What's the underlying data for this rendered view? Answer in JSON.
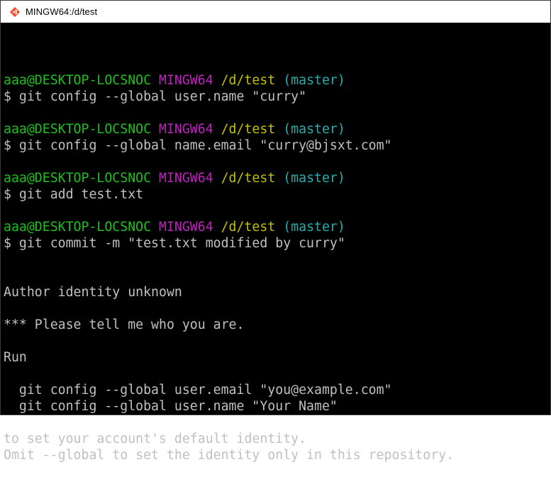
{
  "window": {
    "title": "MINGW64:/d/test",
    "icon": "git-icon"
  },
  "colors": {
    "user": "#1cc21c",
    "system": "#c020c0",
    "path": "#c0c000",
    "branch": "#20b0b0",
    "text": "#c0c0c0",
    "background": "#000000"
  },
  "prompt": {
    "user_host": "aaa@DESKTOP-LOCSNOC",
    "system": "MINGW64",
    "path": "/d/test",
    "branch": "(master)"
  },
  "blocks": [
    {
      "command": "$ git config --global user.name \"curry\""
    },
    {
      "command": "$ git config --global name.email \"curry@bjsxt.com\""
    },
    {
      "command": "$ git add test.txt"
    },
    {
      "command": "$ git commit -m \"test.txt modified by curry\""
    }
  ],
  "output": [
    "Author identity unknown",
    "",
    "*** Please tell me who you are.",
    "",
    "Run",
    "",
    "  git config --global user.email \"you@example.com\"",
    "  git config --global user.name \"Your Name\"",
    "",
    "to set your account's default identity.",
    "Omit --global to set the identity only in this repository."
  ]
}
